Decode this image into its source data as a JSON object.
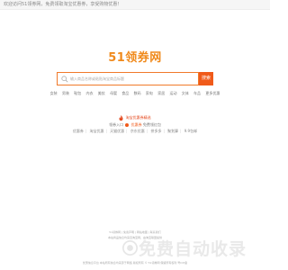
{
  "topbar": {
    "text": "欢迎访问51领券网，免费领取淘宝优惠券，享受购物优惠！"
  },
  "logo": {
    "text": "51领券网"
  },
  "search": {
    "placeholder": "输入商品名称或粘贴淘宝商品标题",
    "button_label": "搜索"
  },
  "categories": [
    "女装",
    "男装",
    "鞋包",
    "内衣",
    "美妆",
    "母婴",
    "食品",
    "数码",
    "家电",
    "家居",
    "运动",
    "文体",
    "车品",
    "更多优惠"
  ],
  "section": {
    "title": "淘宝优惠券精选"
  },
  "entry": {
    "prefix": "领券入口",
    "accent": "优惠券",
    "suffix": "免费领红包"
  },
  "links": [
    "优惠券",
    "淘宝优惠",
    "天猫优惠",
    "京东优惠",
    "拼多多",
    "聚划算",
    "9.9包邮"
  ],
  "footer": {
    "row1": "51领券网 | 免责声明 | 网站地图 | 联系我们",
    "row2": "本站商品信息均来自淘宝网，由淘宝联盟提供",
    "row3": "优惠信息平台 本站所有信息均来源于网络 版权所有 © 51领券网 保留所有权利 粤ICP备"
  },
  "watermark": {
    "text": "免费自动收录"
  },
  "colors": {
    "accent": "#f05a1a",
    "logo": "#f08a1c",
    "hot": "#e4471c"
  }
}
